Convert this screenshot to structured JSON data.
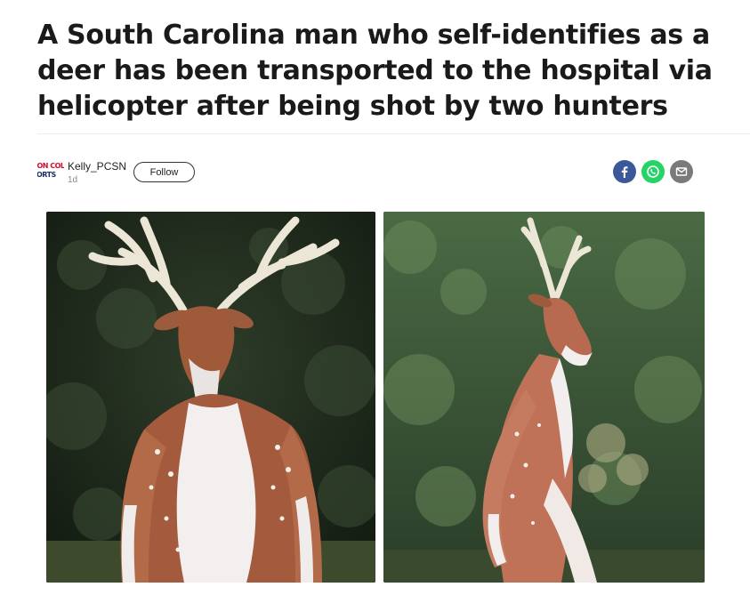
{
  "article": {
    "headline": "A South Carolina man who self-identifies as a deer has been transported to the hospital via helicopter after being shot by two hunters"
  },
  "author": {
    "avatar_text_top": "ION COL",
    "avatar_text_bottom": "ORTS",
    "name": "Kelly_PCSN",
    "time": "1d",
    "follow_label": "Follow"
  },
  "share": {
    "icons": [
      "facebook-icon",
      "whatsapp-icon",
      "mail-icon"
    ],
    "colors": {
      "facebook": "#3b5998",
      "whatsapp": "#25d366",
      "mail": "#7a7a7a"
    }
  },
  "images": [
    {
      "subject": "person in deer body paint with antlers, front view"
    },
    {
      "subject": "person in deer body paint with antlers, side view in woods"
    }
  ]
}
